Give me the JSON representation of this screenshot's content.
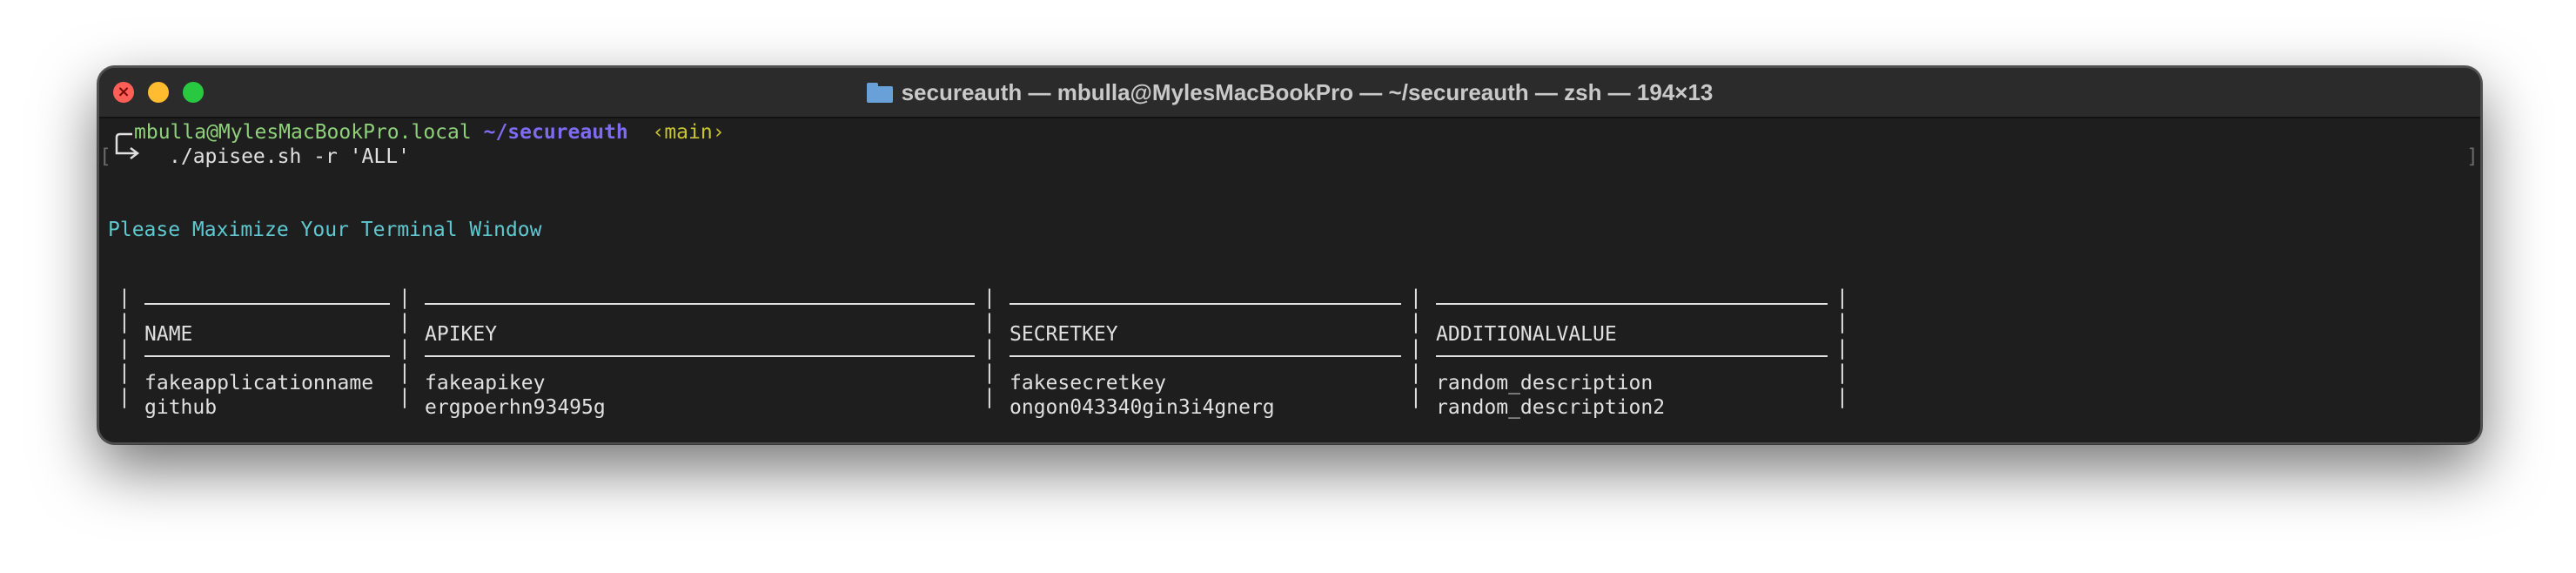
{
  "window": {
    "title": "secureauth — mbulla@MylesMacBookPro — ~/secureauth — zsh — 194×13",
    "folder_icon": "folder-icon"
  },
  "prompt": {
    "user_host": "mbulla@MylesMacBookPro.local",
    "path": "~/secureauth",
    "branch": "‹main›",
    "command": "./apisee.sh -r 'ALL'",
    "left_bracket": "[",
    "right_bracket": "]"
  },
  "message": "Please Maximize Your Terminal Window",
  "table": {
    "headers": [
      "NAME",
      "APIKEY",
      "SECRETKEY",
      "ADDITIONALVALUE"
    ],
    "rows": [
      [
        "fakeapplicationname",
        "fakeapikey",
        "fakesecretkey",
        "random_description"
      ],
      [
        "github",
        "ergpoerhn93495g",
        "ongon043340gin3i4gnerg",
        "random_description2"
      ]
    ],
    "separator": "|"
  }
}
